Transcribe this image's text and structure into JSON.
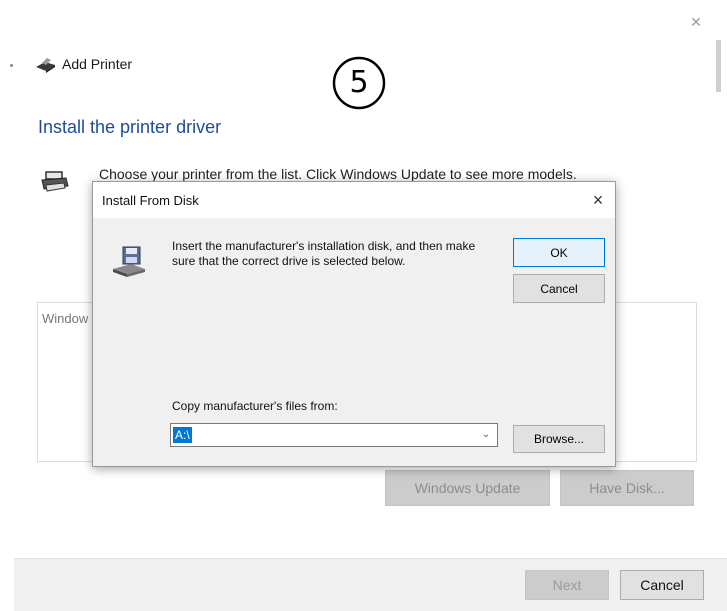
{
  "wizard": {
    "title": "Add Printer",
    "close_glyph": "×",
    "step_number": "5",
    "heading": "Install the printer driver",
    "instruction": "Choose your printer from the list. Click Windows Update to see more models.",
    "list_first_item": "Window",
    "windows_update_label": "Windows Update",
    "have_disk_label": "Have Disk...",
    "next_label": "Next",
    "cancel_label": "Cancel"
  },
  "dialog": {
    "title": "Install From Disk",
    "close_glyph": "×",
    "message": "Insert the manufacturer's installation disk, and then make sure that the correct drive is selected below.",
    "ok_label": "OK",
    "cancel_label": "Cancel",
    "copy_label": "Copy manufacturer's files from:",
    "path_value": "A:\\",
    "browse_label": "Browse..."
  },
  "icons": {
    "wizard_title": "printer-icon",
    "instruction": "printer-icon",
    "dialog": "floppy-disk-icon",
    "combo_arrow": "chevron-down-icon"
  },
  "colors": {
    "heading": "#1e4c9a",
    "accent": "#0078d7"
  }
}
